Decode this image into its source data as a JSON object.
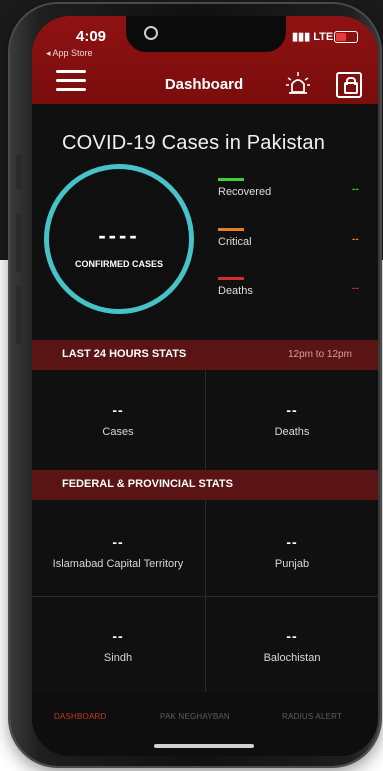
{
  "status_bar": {
    "time": "4:09",
    "back_to": "◂ App Store",
    "carrier": "LTE"
  },
  "header": {
    "title": "Dashboard",
    "menu_icon": "hamburger-icon",
    "alert_icon": "siren-icon",
    "lock_icon": "lock-icon"
  },
  "summary": {
    "heading": "COVID-19 Cases in Pakistan",
    "confirmed_value": "----",
    "confirmed_label": "CONFIRMED CASES",
    "ring_color": "#47c2c7",
    "legend": [
      {
        "label": "Recovered",
        "value": "--",
        "color": "#3bcf3b"
      },
      {
        "label": "Critical",
        "value": "--",
        "color": "#e67e22"
      },
      {
        "label": "Deaths",
        "value": "--",
        "color": "#d62b2b"
      }
    ]
  },
  "last24": {
    "title": "LAST 24 HOURS STATS",
    "range": "12pm to 12pm",
    "items": [
      {
        "value": "--",
        "label": "Cases"
      },
      {
        "value": "--",
        "label": "Deaths"
      }
    ]
  },
  "provincial": {
    "title": "FEDERAL & PROVINCIAL STATS",
    "items": [
      {
        "value": "--",
        "label": "Islamabad Capital Territory"
      },
      {
        "value": "--",
        "label": "Punjab"
      },
      {
        "value": "--",
        "label": "Sindh"
      },
      {
        "value": "--",
        "label": "Balochistan"
      }
    ]
  },
  "nav": {
    "items": [
      {
        "label": "DASHBOARD",
        "active": true
      },
      {
        "label": "PAK NEGHAYBAN",
        "active": false
      },
      {
        "label": "RADIUS ALERT",
        "active": false
      }
    ]
  },
  "colors": {
    "header": "#8f1212",
    "section": "#5a1414",
    "active_nav": "#c0392b",
    "inactive_nav": "#5e5e5e"
  }
}
